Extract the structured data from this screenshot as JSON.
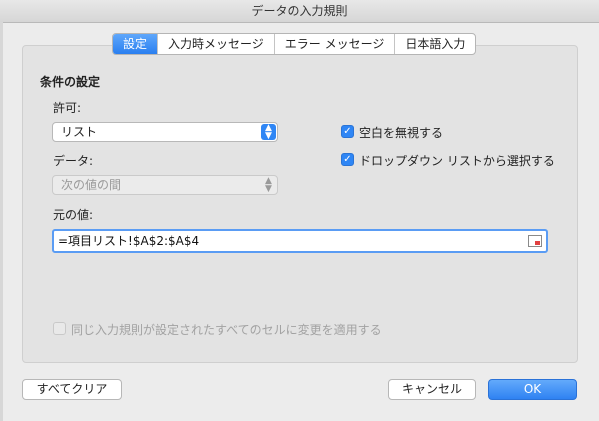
{
  "window": {
    "title": "データの入力規則"
  },
  "tabs": [
    {
      "label": "設定",
      "active": true
    },
    {
      "label": "入力時メッセージ",
      "active": false
    },
    {
      "label": "エラー メッセージ",
      "active": false
    },
    {
      "label": "日本語入力",
      "active": false
    }
  ],
  "settings": {
    "section_title": "条件の設定",
    "allow_label": "許可:",
    "allow_value": "リスト",
    "data_label": "データ:",
    "data_value": "次の値の間",
    "source_label": "元の値:",
    "source_value": "=項目リスト!$A$2:$A$4",
    "ignore_blank": {
      "label": "空白を無視する",
      "checked": true
    },
    "in_cell_dropdown": {
      "label": "ドロップダウン リストから選択する",
      "checked": true
    },
    "apply_all": {
      "label": "同じ入力規則が設定されたすべてのセルに変更を適用する",
      "checked": false
    }
  },
  "footer": {
    "clear_all": "すべてクリア",
    "cancel": "キャンセル",
    "ok": "OK"
  },
  "colors": {
    "accent": "#2f86f5"
  }
}
